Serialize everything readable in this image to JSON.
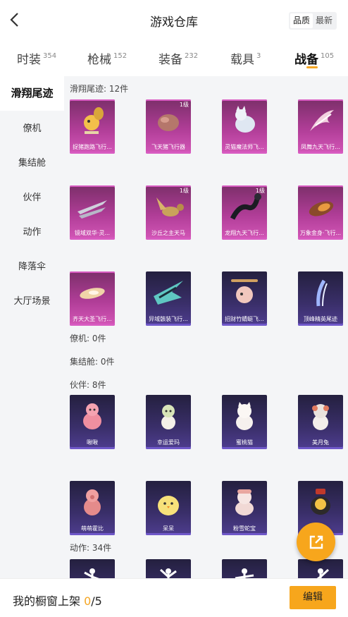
{
  "header": {
    "title": "游戏仓库",
    "sort_options": [
      "品质",
      "最新"
    ]
  },
  "tabs": [
    {
      "label": "时装",
      "count": "354"
    },
    {
      "label": "枪械",
      "count": "152"
    },
    {
      "label": "装备",
      "count": "232"
    },
    {
      "label": "载具",
      "count": "3"
    },
    {
      "label": "战备",
      "count": "105"
    }
  ],
  "sidebar": {
    "items": [
      "滑翔尾迹",
      "僚机",
      "集结舱",
      "伙伴",
      "动作",
      "降落伞",
      "大厅场景"
    ]
  },
  "sections": {
    "glide": {
      "label": "滑翔尾迹: 12件"
    },
    "wingman": {
      "label": "僚机: 0件"
    },
    "capsule": {
      "label": "集结舱: 0件"
    },
    "partner": {
      "label": "伙伴: 8件"
    },
    "action": {
      "label": "动作: 34件"
    }
  },
  "glide_items": [
    {
      "name": "捉猪跑路飞行...",
      "level": ""
    },
    {
      "name": "飞天猪飞行器",
      "level": "1级"
    },
    {
      "name": "灵猫魔法师飞...",
      "level": ""
    },
    {
      "name": "凤舞九天飞行...",
      "level": ""
    },
    {
      "name": "镜域双华·灵...",
      "level": ""
    },
    {
      "name": "沙丘之主天马",
      "level": "1级"
    },
    {
      "name": "龙翔九天飞行...",
      "level": "1级"
    },
    {
      "name": "万象金身·飞行...",
      "level": ""
    },
    {
      "name": "齐天大圣飞行...",
      "level": ""
    },
    {
      "name": "异域骸装飞行...",
      "level": ""
    },
    {
      "name": "招财竹蜻蜓飞...",
      "level": ""
    },
    {
      "name": "顶峰精英尾迹",
      "level": ""
    }
  ],
  "partner_items": [
    {
      "name": "啾啾"
    },
    {
      "name": "幸运爱玛"
    },
    {
      "name": "蜜桃猫"
    },
    {
      "name": "美月兔"
    },
    {
      "name": "萌萌霍比"
    },
    {
      "name": "呆呆"
    },
    {
      "name": "粉雪蛇宝"
    },
    {
      "name": ""
    }
  ],
  "footer": {
    "prefix": "我的橱窗上架 ",
    "current": "0",
    "suffix": "/5",
    "edit_label": "编辑"
  },
  "colors": {
    "accent": "#f7a61c",
    "card_pink": "#b03d97",
    "card_purple": "#3a2f6a"
  },
  "icons": {
    "back": "chevron-left-icon",
    "float": "share-out-icon"
  }
}
